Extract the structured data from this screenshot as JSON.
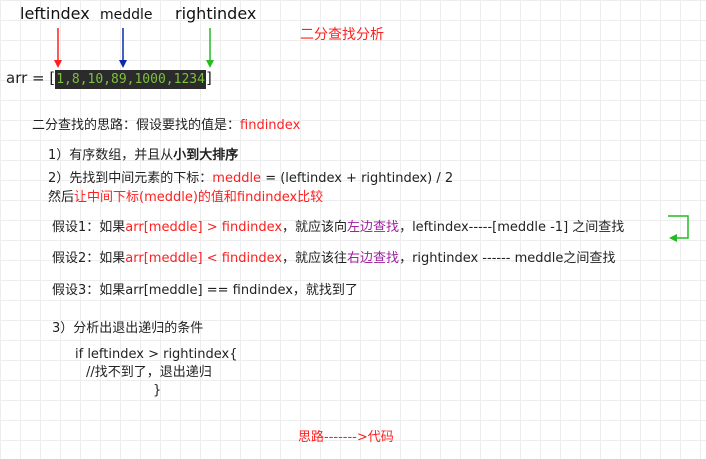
{
  "labels": {
    "left": "leftindex",
    "mid": "meddle",
    "right": "rightindex"
  },
  "title": "二分查找分析",
  "arr": {
    "prefix": "arr = [",
    "values": "1,8,10,89,1000,1234",
    "suffix": "]"
  },
  "idea": {
    "prefix": "二分查找的思路：假设要找的值是：",
    "var": "findindex"
  },
  "step1": {
    "text": "1）有序数组，并且从",
    "bold": "小到大排序"
  },
  "step2": {
    "line1_prefix": "2）先找到中间元素的下标：",
    "line1_red": "meddle",
    "line1_suffix": " = (leftindex + rightindex) / 2",
    "line2_prefix": "然后",
    "line2_red": "让中间下标(meddle)的值和findindex比较"
  },
  "case1": {
    "a": "假设1：如果",
    "b": "arr[meddle] >  findindex",
    "c": "，就应该向",
    "d": "左边查找",
    "e": "，leftindex-----[meddle -1] 之间查找"
  },
  "case2": {
    "a": "假设2：如果",
    "b": "arr[meddle] < findindex",
    "c": "，就应该往",
    "d": "右边查找",
    "e": "，rightindex ------ meddle之间查找"
  },
  "case3": {
    "text": "假设3：如果arr[meddle] == findindex，就找到了"
  },
  "step3": {
    "text": "3）分析出退出递归的条件"
  },
  "code": {
    "line1": "if  leftindex >  rightindex{",
    "line2": "//找不到了，退出递归",
    "line3": "}"
  },
  "footer": "思路------->代码",
  "colors": {
    "red": "#ff2020",
    "blue": "#0a2aa8",
    "green": "#22bb22",
    "purple": "#a020a0",
    "code_bg": "#2b2b2b",
    "code_fg": "#7fbf3f"
  }
}
